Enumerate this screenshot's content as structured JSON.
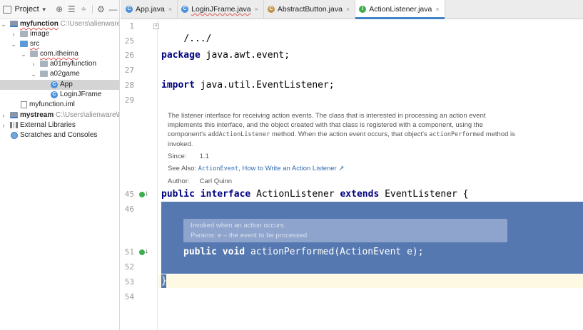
{
  "project_panel": {
    "title": "Project",
    "tree": [
      {
        "name": "myfunction",
        "path": "C:\\Users\\alienware\\Id"
      },
      {
        "name": "image"
      },
      {
        "name": "src"
      },
      {
        "name": "com.itheima"
      },
      {
        "name": "a01myfunction"
      },
      {
        "name": "a02game"
      },
      {
        "name": "App"
      },
      {
        "name": "LoginJFrame"
      },
      {
        "name": "myfunction.iml"
      },
      {
        "name": "mystream",
        "path": "C:\\Users\\alienware\\Ide"
      },
      {
        "name": "External Libraries"
      },
      {
        "name": "Scratches and Consoles"
      }
    ]
  },
  "tabs": [
    {
      "label": "App.java",
      "close": "×"
    },
    {
      "label": "LoginJFrame.java",
      "close": "×"
    },
    {
      "label": "AbstractButton.java",
      "close": "×"
    },
    {
      "label": "ActionListener.java",
      "close": "×"
    }
  ],
  "editor": {
    "line_numbers": [
      "1",
      "25",
      "26",
      "27",
      "28",
      "29",
      "45",
      "46",
      "51",
      "52",
      "53",
      "54"
    ],
    "folded_header": "/.../",
    "package_kw": "package",
    "package_name": "java.awt.event;",
    "import_kw": "import",
    "import_name": "java.util.EventListener;",
    "doc": {
      "p1": "The listener interface for receiving action events. The class that is interested in processing an action event implements this interface, and the object created with that class is registered with a component, using the component's",
      "p1_code": "addActionListener",
      "p1_end": "method. When the action event occurs, that object's",
      "p1_code2": "actionPerformed",
      "p1_end2": "method is invoked.",
      "since_label": "Since:",
      "since_value": "1.1",
      "see_also_label": "See Also:",
      "see_also_link1": "ActionEvent",
      "see_also_sep": ",",
      "see_also_link2": "How to Write an Action Listener ↗",
      "author_label": "Author:",
      "author_value": "Carl Quinn"
    },
    "interface_line": {
      "kw1": "public",
      "kw2": "interface",
      "name": "ActionListener",
      "kw3": "extends",
      "parent": "EventListener {"
    },
    "method_doc": {
      "line1": "Invoked when an action occurs.",
      "line2": "Params: e – the event to be processed"
    },
    "method_line": {
      "kw1": "public",
      "kw2": "void",
      "signature": "actionPerformed(ActionEvent e);"
    },
    "closing_brace": "}"
  }
}
